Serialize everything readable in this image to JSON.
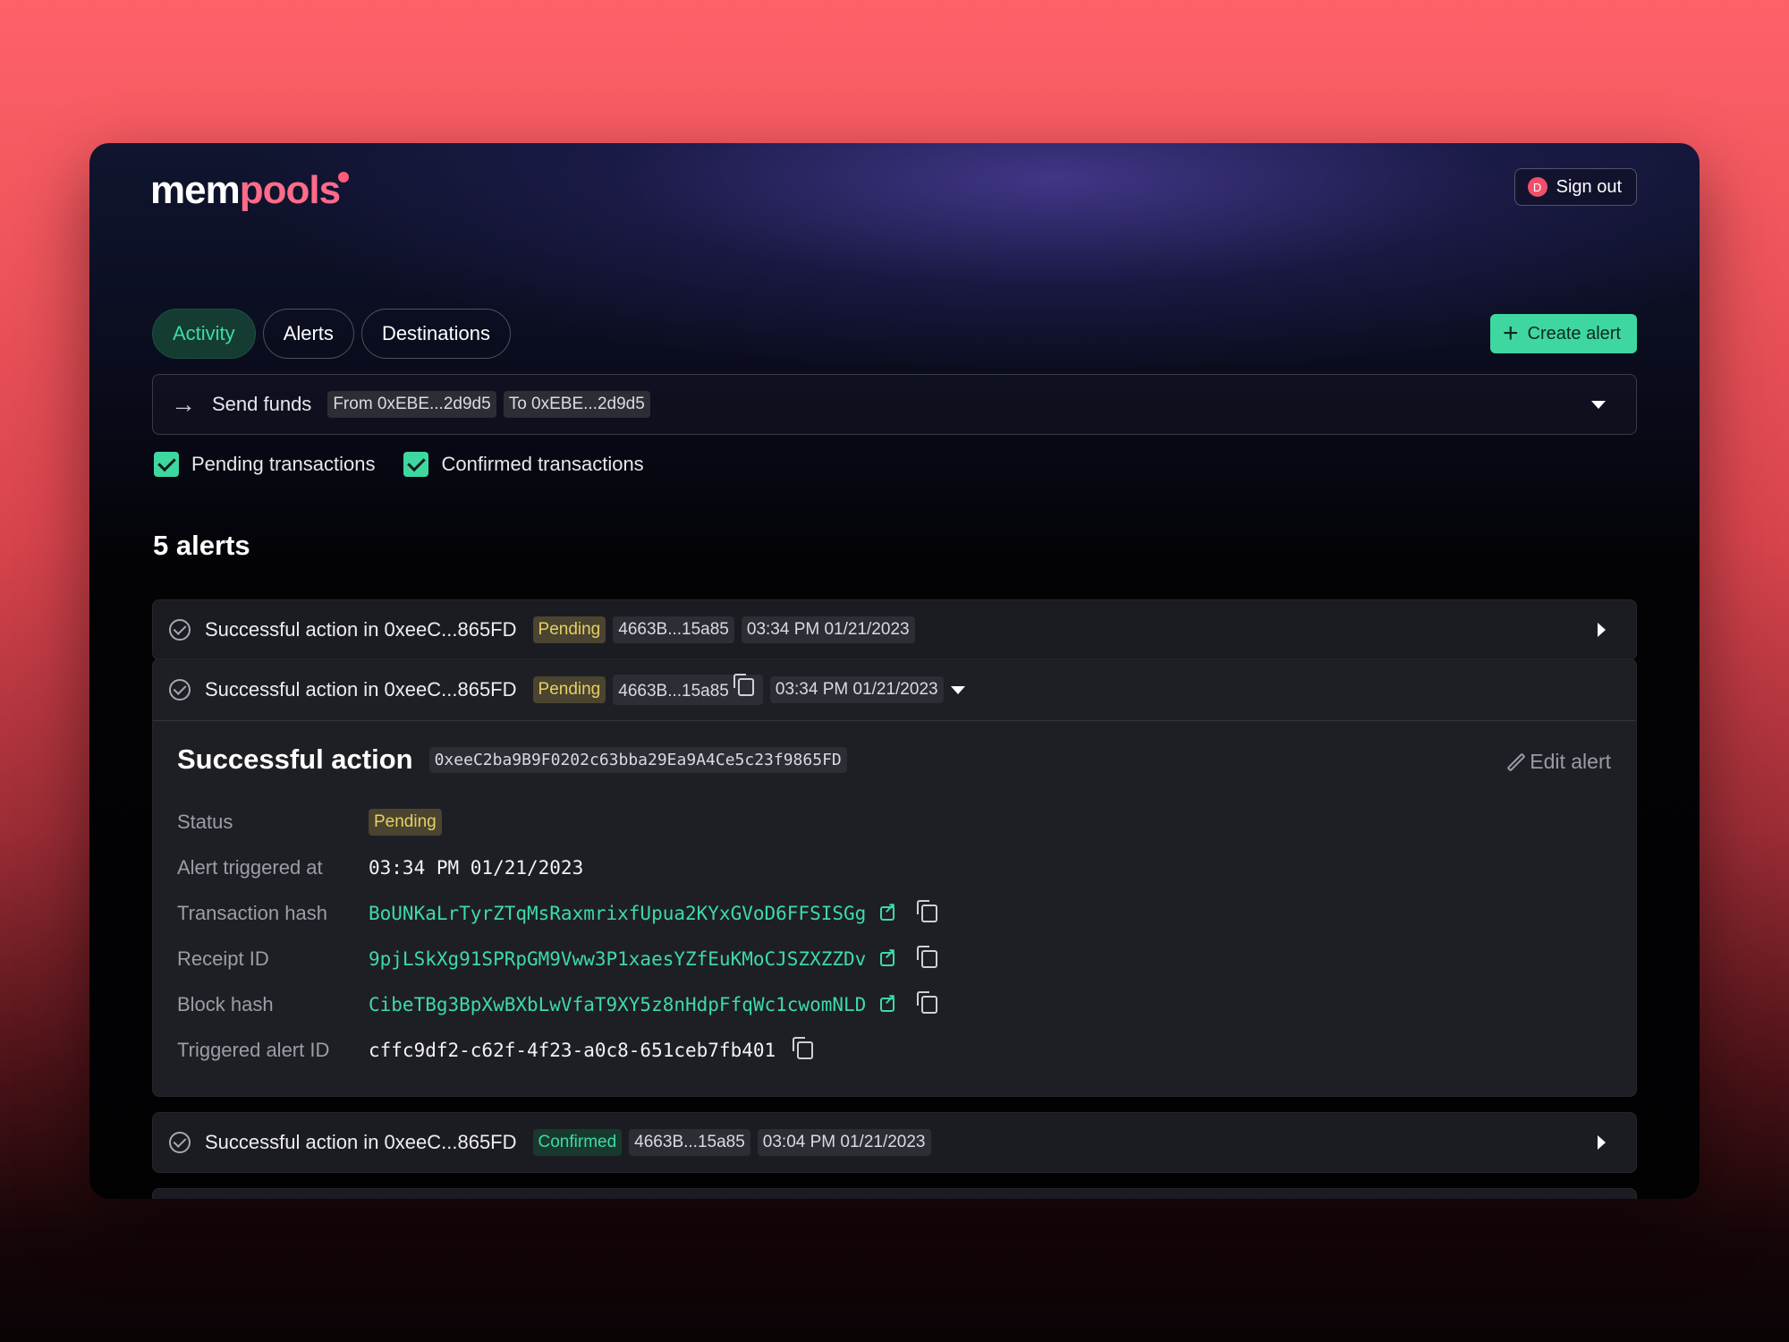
{
  "brand": {
    "logo_part1": "mem",
    "logo_part2": "pools"
  },
  "header": {
    "signout_label": "Sign out",
    "avatar_initial": "D"
  },
  "tabs": [
    {
      "label": "Activity",
      "active": true
    },
    {
      "label": "Alerts"
    },
    {
      "label": "Destinations"
    }
  ],
  "create_alert_label": "Create alert",
  "filter": {
    "action": "Send funds",
    "from_chip": "From 0xEBE...2d9d5",
    "to_chip": "To 0xEBE...2d9d5"
  },
  "checkboxes": [
    {
      "label": "Pending transactions",
      "checked": true
    },
    {
      "label": "Confirmed transactions",
      "checked": true
    }
  ],
  "alerts_count": "5 alerts",
  "rows": [
    {
      "title": "Successful action in 0xeeC...865FD",
      "status": "Pending",
      "hash": "4663B...15a85",
      "time": "03:34 PM 01/21/2023"
    },
    {
      "title": "Successful action in 0xeeC...865FD",
      "status": "Pending",
      "hash": "4663B...15a85",
      "time": "03:34 PM 01/21/2023"
    },
    {
      "title": "Successful action in 0xeeC...865FD",
      "status": "Confirmed",
      "hash": "4663B...15a85",
      "time": "03:04 PM 01/21/2023"
    }
  ],
  "detail": {
    "title": "Successful action",
    "address": "0xeeC2ba9B9F0202c63bba29Ea9A4Ce5c23f9865FD",
    "edit_label": "Edit alert",
    "labels": {
      "status": "Status",
      "triggered_at": "Alert triggered at",
      "tx_hash": "Transaction hash",
      "receipt_id": "Receipt ID",
      "block_hash": "Block hash",
      "alert_id": "Triggered alert ID"
    },
    "values": {
      "status": "Pending",
      "triggered_at": "03:34 PM 01/21/2023",
      "tx_hash": "BoUNKaLrTyrZTqMsRaxmrixfUpua2KYxGVoD6FFSISGg",
      "receipt_id": "9pjLSkXg91SPRpGM9Vww3P1xaesYZfEuKMoCJSZXZZDv",
      "block_hash": "CibeTBg3BpXwBXbLwVfaT9XY5z8nHdpFfqWc1cwomNLD",
      "alert_id": "cffc9df2-c62f-4f23-a0c8-651ceb7fb401"
    }
  },
  "colors": {
    "accent": "#3fd7a0",
    "pending": "#e8cf63",
    "brand_pink": "#ff6b8a"
  }
}
